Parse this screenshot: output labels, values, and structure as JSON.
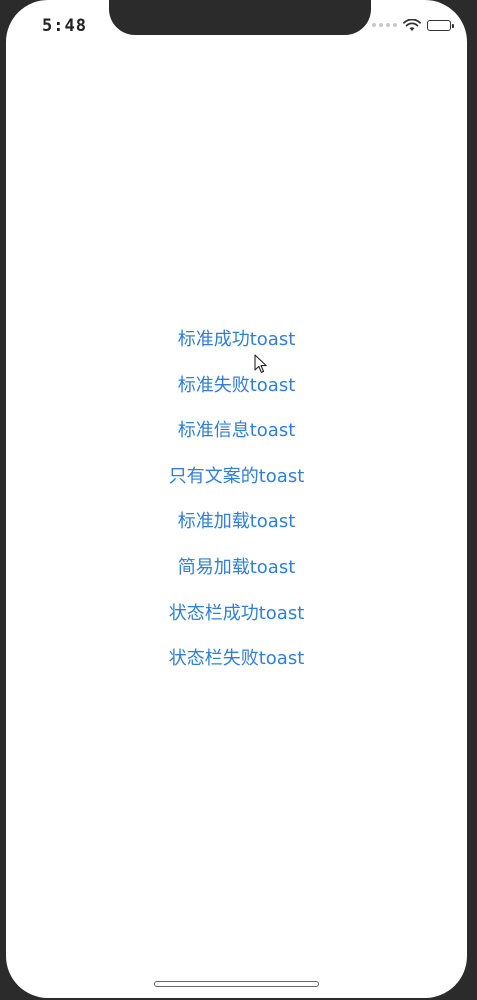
{
  "status_bar": {
    "time": "5:48",
    "icons": [
      "signal-icon",
      "wifi-icon",
      "battery-icon"
    ]
  },
  "menu": {
    "items": [
      {
        "label": "标准成功toast"
      },
      {
        "label": "标准失败toast"
      },
      {
        "label": "标准信息toast"
      },
      {
        "label": "只有文案的toast"
      },
      {
        "label": "标准加载toast"
      },
      {
        "label": "简易加载toast"
      },
      {
        "label": "状态栏成功toast"
      },
      {
        "label": "状态栏失败toast"
      }
    ]
  },
  "colors": {
    "accent": "#2f7fd9",
    "background": "#ffffff",
    "frame": "#2b2b2b"
  }
}
